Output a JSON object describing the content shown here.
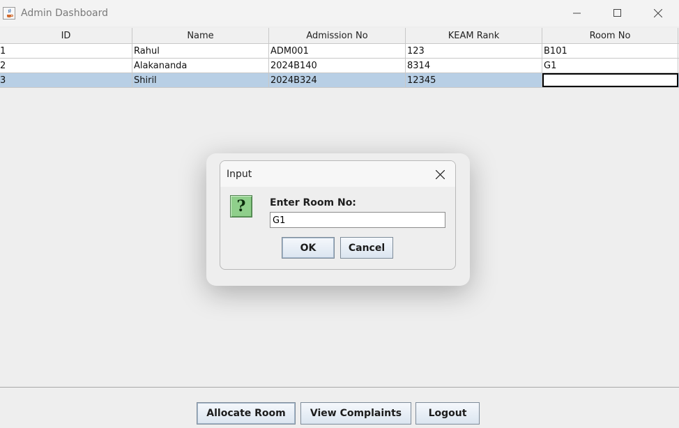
{
  "window": {
    "title": "Admin Dashboard"
  },
  "table": {
    "columns": [
      "ID",
      "Name",
      "Admission No",
      "KEAM Rank",
      "Room No"
    ],
    "rows": [
      [
        "1",
        "Rahul",
        "ADM001",
        "123",
        "B101"
      ],
      [
        "2",
        "Alakananda",
        "2024B140",
        "8314",
        "G1"
      ],
      [
        "3",
        "Shiril",
        "2024B324",
        "12345",
        ""
      ]
    ],
    "selected_row": 3
  },
  "dialog": {
    "title": "Input",
    "prompt": "Enter Room No:",
    "input_value": "G1",
    "ok_label": "OK",
    "cancel_label": "Cancel",
    "icon": "question-icon",
    "icon_glyph": "?"
  },
  "bottom": {
    "allocate_label": "Allocate Room",
    "complaints_label": "View Complaints",
    "logout_label": "Logout"
  }
}
